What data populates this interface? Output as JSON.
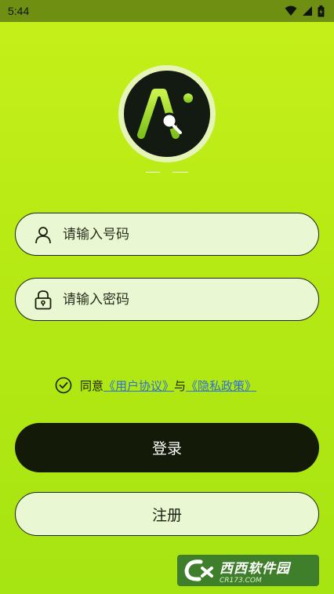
{
  "status_bar": {
    "time": "5:44"
  },
  "login": {
    "phone_placeholder": "请输入号码",
    "password_placeholder": "请输入密码",
    "agree_prefix": "同意",
    "user_agreement": "《用户协议》",
    "connector": "与",
    "privacy_policy": "《隐私政策》",
    "login_button": "登录",
    "register_button": "注册"
  },
  "watermark": {
    "brand": "西西软件园",
    "url": "CR173.COM"
  },
  "colors": {
    "accent": "#c6f01a",
    "button_dark": "#141a08",
    "link": "#2f6fd6"
  }
}
